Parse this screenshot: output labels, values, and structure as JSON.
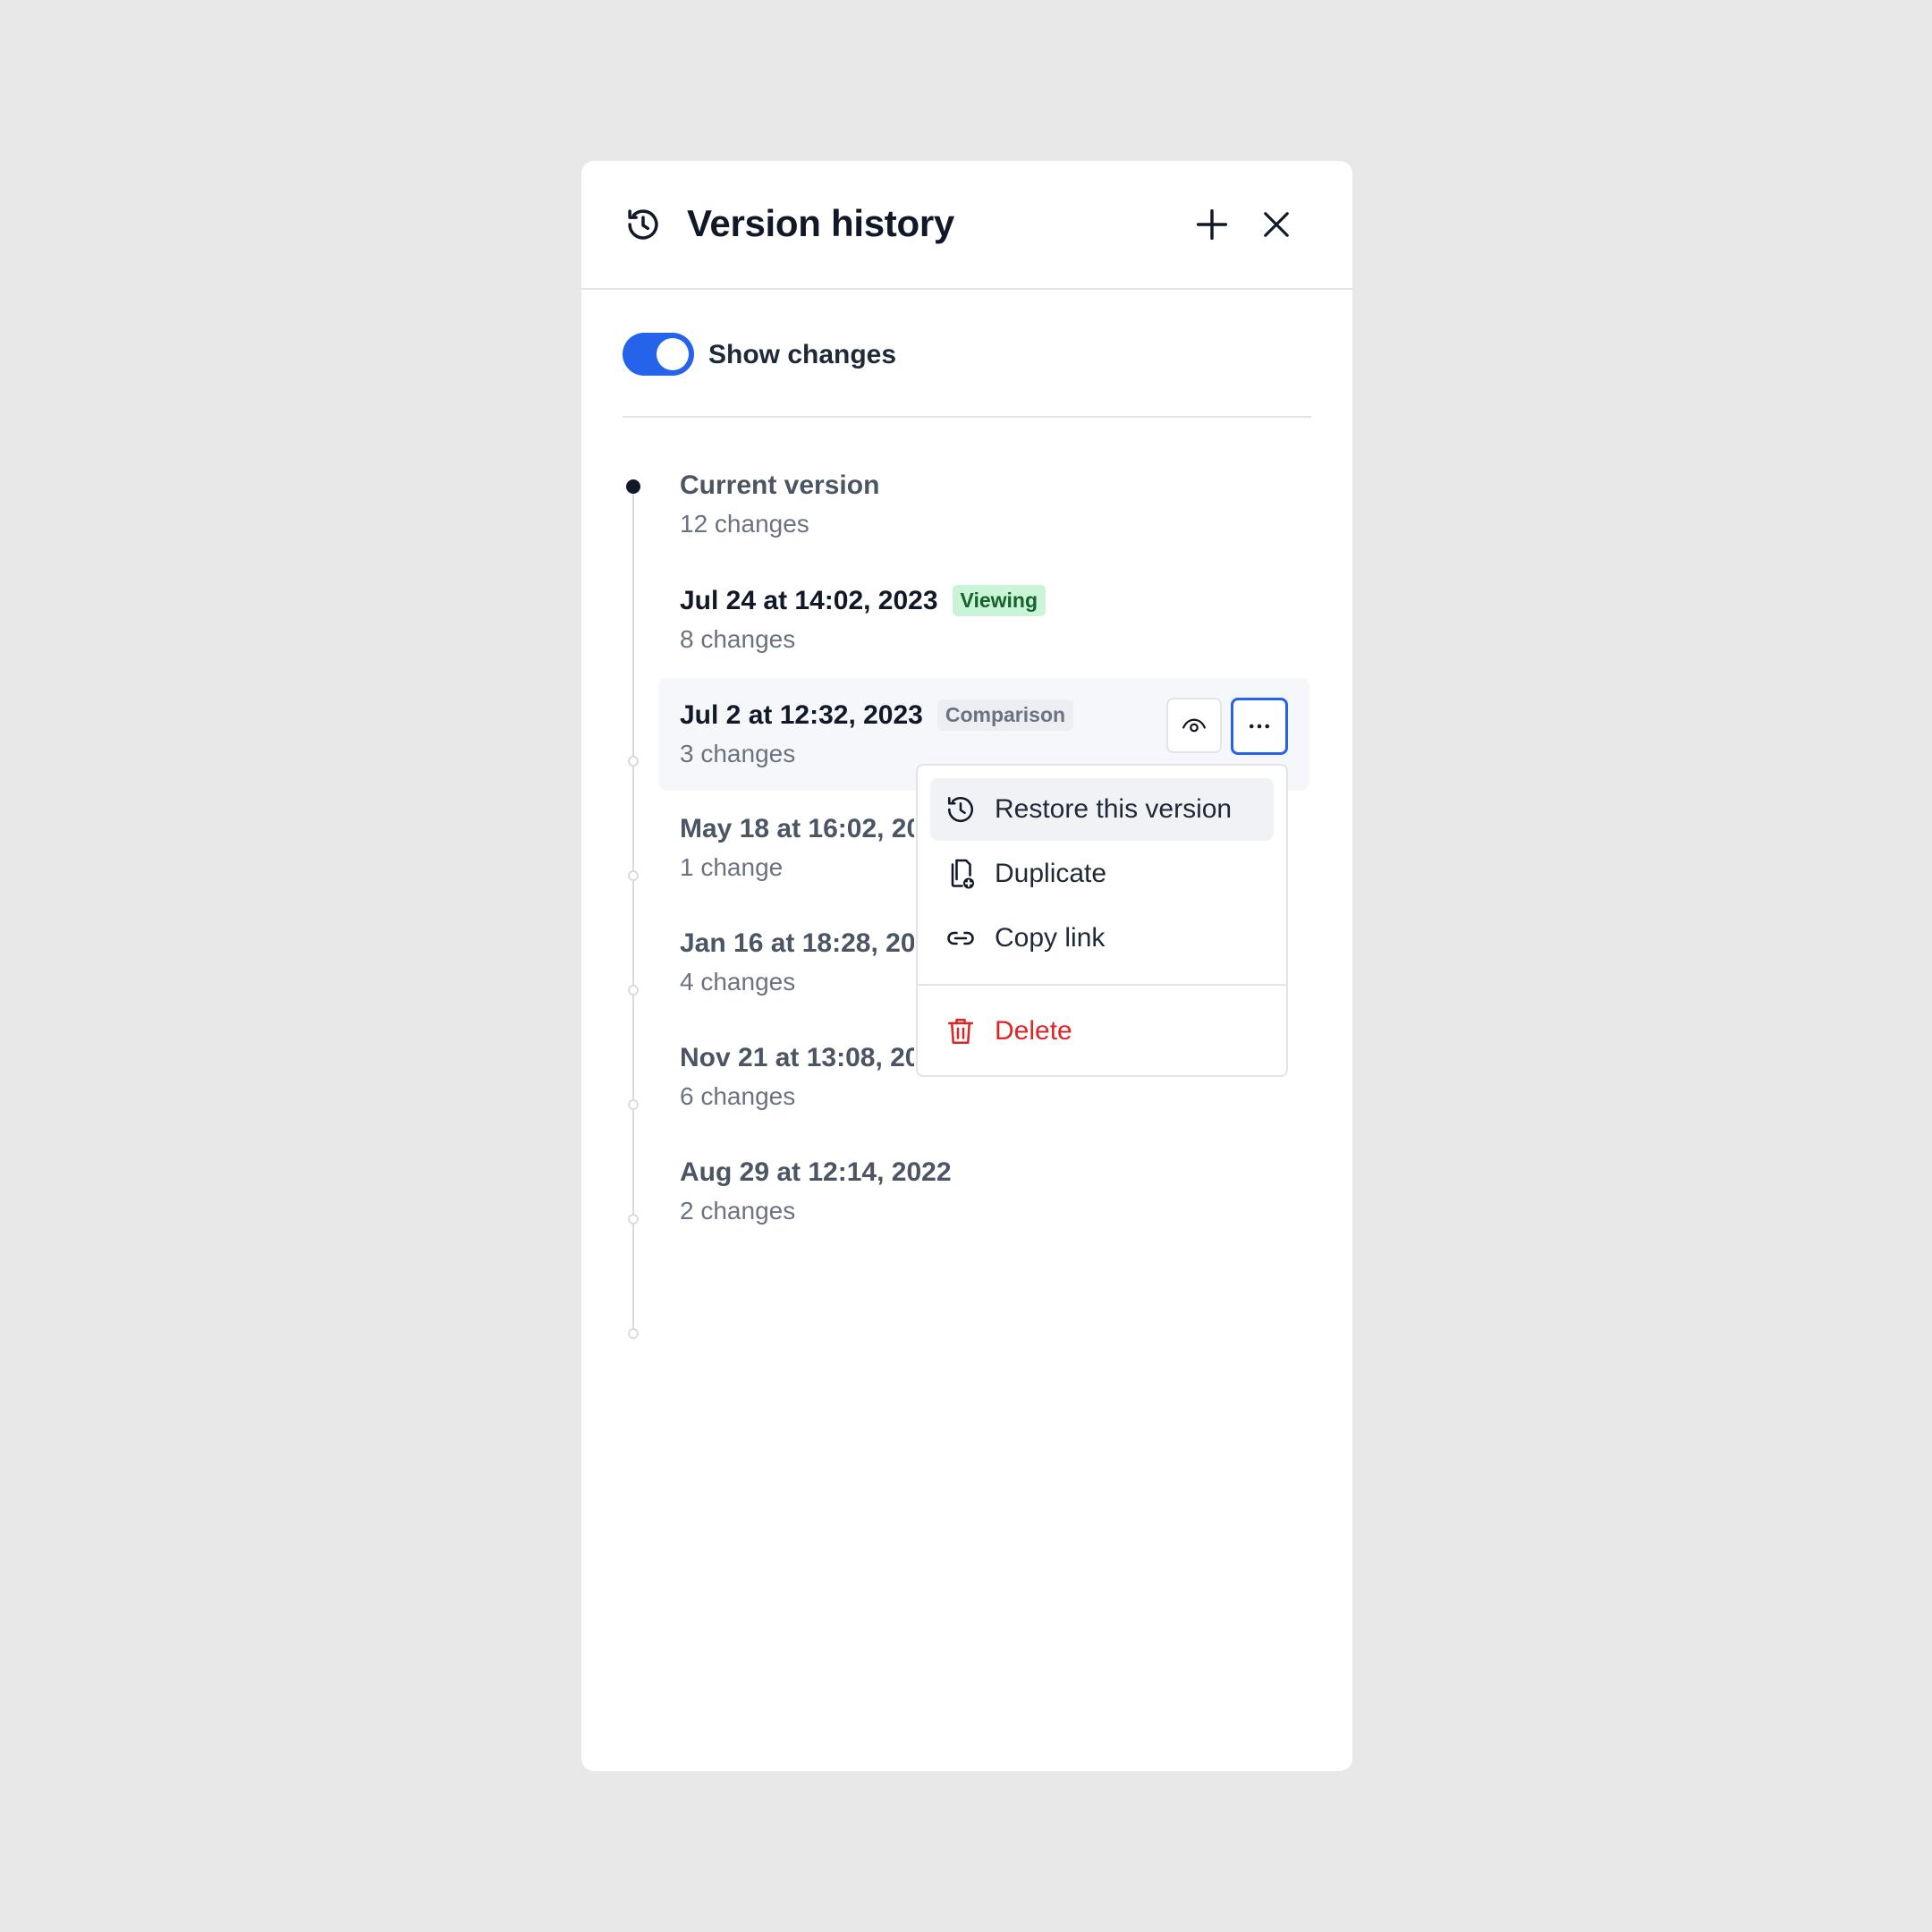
{
  "header": {
    "title": "Version history",
    "history_icon": "history-icon",
    "add_icon": "plus-icon",
    "close_icon": "close-icon"
  },
  "toggle": {
    "label": "Show changes",
    "on": true
  },
  "versions": [
    {
      "date": "Current version",
      "changes": "12 changes"
    },
    {
      "date": "Jul 24 at 14:02, 2023",
      "changes": "8 changes",
      "badge": "Viewing"
    },
    {
      "date": "Jul 2 at 12:32, 2023",
      "changes": "3 changes",
      "badge": "Comparison"
    },
    {
      "date": "May 18 at 16:02, 2023",
      "changes": "1 change"
    },
    {
      "date": "Jan 16 at 18:28, 2023",
      "changes": "4 changes"
    },
    {
      "date": "Nov 21 at 13:08, 2022",
      "changes": "6 changes"
    },
    {
      "date": "Aug 29 at 12:14, 2022",
      "changes": "2 changes"
    }
  ],
  "menu": {
    "items": [
      {
        "label": "Restore this version",
        "icon": "history-icon"
      },
      {
        "label": "Duplicate",
        "icon": "duplicate-icon"
      },
      {
        "label": "Copy link",
        "icon": "link-icon"
      },
      {
        "label": "Delete",
        "icon": "trash-icon"
      }
    ]
  },
  "colors": {
    "accent": "#2563eb",
    "danger": "#dc2626",
    "viewing_bg": "#c9f4d6",
    "background": "#e8e8e8"
  }
}
